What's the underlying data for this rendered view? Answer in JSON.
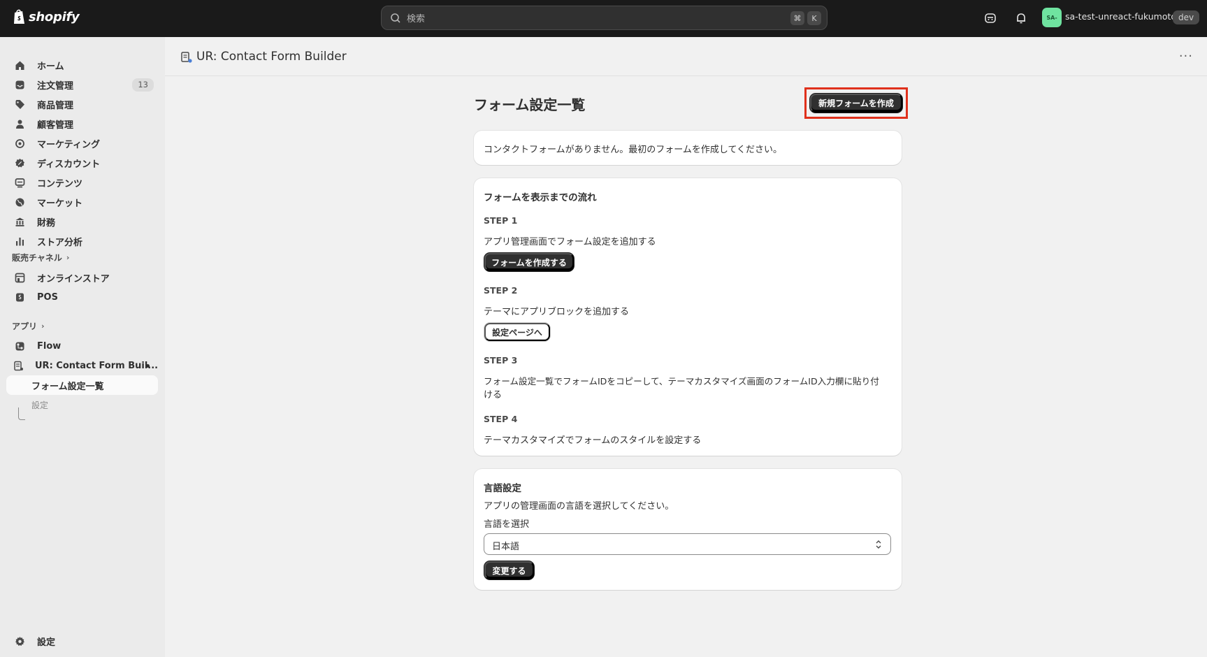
{
  "topbar": {
    "brand": "shopify",
    "search_placeholder": "検索",
    "shortcut_cmd": "⌘",
    "shortcut_key": "K",
    "avatar_initials": "SA-",
    "store_name": "sa-test-unreact-fukumoto",
    "env_badge": "dev"
  },
  "sidebar": {
    "items": [
      {
        "label": "ホーム",
        "icon": "home-icon"
      },
      {
        "label": "注文管理",
        "icon": "inbox-icon",
        "count": "13"
      },
      {
        "label": "商品管理",
        "icon": "tag-icon"
      },
      {
        "label": "顧客管理",
        "icon": "person-icon"
      },
      {
        "label": "マーケティング",
        "icon": "target-icon"
      },
      {
        "label": "ディスカウント",
        "icon": "discount-icon"
      },
      {
        "label": "コンテンツ",
        "icon": "content-icon"
      },
      {
        "label": "マーケット",
        "icon": "globe-icon"
      },
      {
        "label": "財務",
        "icon": "bank-icon"
      },
      {
        "label": "ストア分析",
        "icon": "bar-chart-icon"
      }
    ],
    "sales_channels_label": "販売チャネル",
    "sales_channels": [
      {
        "label": "オンラインストア",
        "icon": "store-icon"
      },
      {
        "label": "POS",
        "icon": "pos-icon"
      }
    ],
    "apps_label": "アプリ",
    "apps": [
      {
        "label": "Flow",
        "icon": "flow-icon"
      },
      {
        "label": "UR: Contact Form Buil...",
        "icon": "form-app-icon"
      }
    ],
    "app_subitems": [
      {
        "label": "フォーム設定一覧",
        "active": true
      },
      {
        "label": "設定",
        "active": false
      }
    ],
    "settings_label": "設定"
  },
  "header": {
    "app_title": "UR: Contact Form Builder"
  },
  "main": {
    "page_title": "フォーム設定一覧",
    "new_form_button": "新規フォームを作成",
    "empty_message": "コンタクトフォームがありません。最初のフォームを作成してください。",
    "flow_card": {
      "title": "フォームを表示までの流れ",
      "steps": [
        {
          "heading": "STEP 1",
          "text": "アプリ管理画面でフォーム設定を追加する",
          "button": "フォームを作成する"
        },
        {
          "heading": "STEP 2",
          "text": "テーマにアプリブロックを追加する",
          "button": "設定ページへ"
        },
        {
          "heading": "STEP 3",
          "text_line1": "フォーム設定一覧でフォームIDをコピーして、テーマカスタマイズ画面のフォームID入力欄に貼り付",
          "text_line2": "ける"
        },
        {
          "heading": "STEP 4",
          "text": "テーマカスタマイズでフォームのスタイルを設定する"
        }
      ]
    },
    "language_card": {
      "title": "言語設定",
      "description": "アプリの管理画面の言語を選択してください。",
      "select_label": "言語を選択",
      "selected_value": "日本語",
      "submit_button": "変更する"
    }
  },
  "colors": {
    "topbar_bg": "#1a1a1a",
    "highlight_border": "#e0311c",
    "primary_button": "#303030",
    "avatar_bg": "#6fe3a0"
  }
}
